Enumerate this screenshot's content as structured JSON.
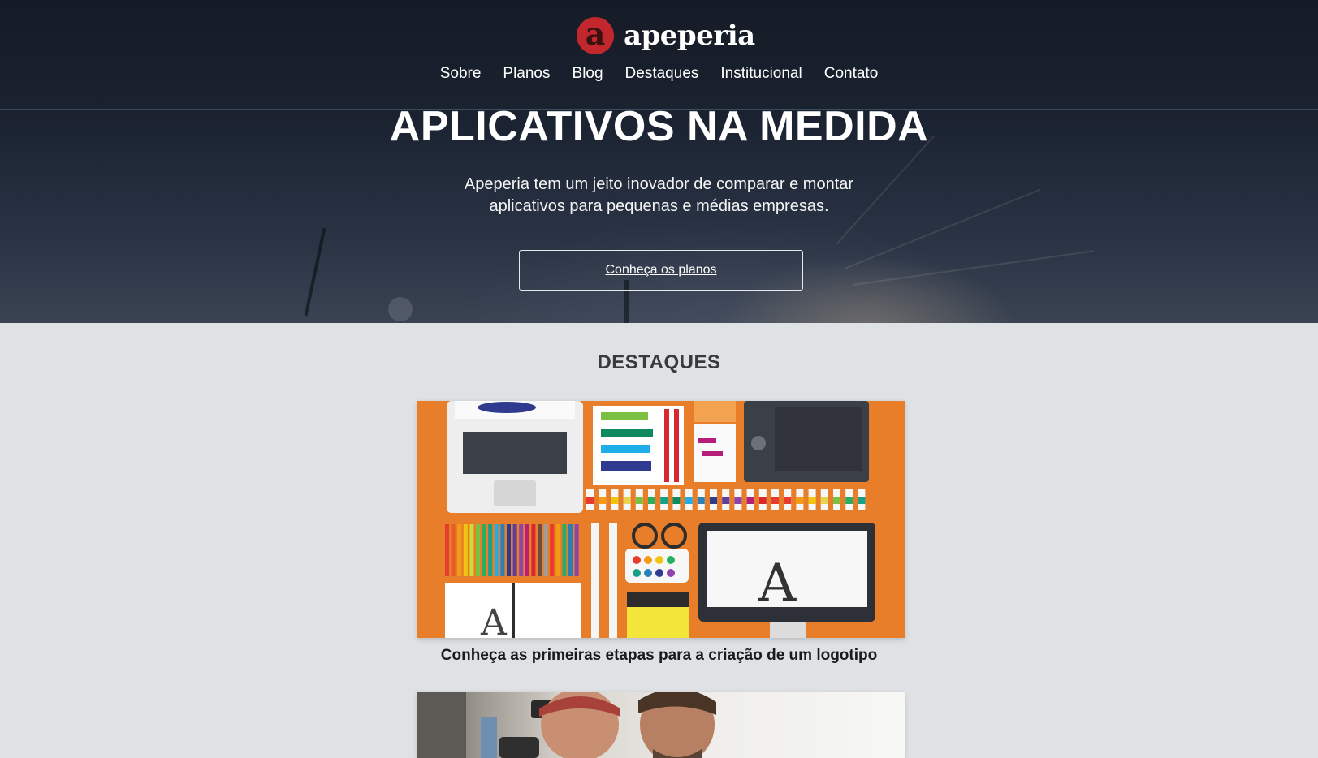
{
  "header": {
    "logo_letter": "a",
    "logo_name": "apeperia",
    "nav": [
      "Sobre",
      "Planos",
      "Blog",
      "Destaques",
      "Institucional",
      "Contato"
    ]
  },
  "hero": {
    "title": "APLICATIVOS NA MEDIDA",
    "subtitle": "Apeperia tem um jeito inovador de comparar e montar aplicativos para pequenas e médias empresas.",
    "cta_label": "Conheça os planos"
  },
  "highlights": {
    "title": "DESTAQUES",
    "cards": [
      {
        "caption": "Conheça as primeiras etapas para a criação de um logotipo"
      }
    ]
  },
  "colors": {
    "brand": "#c1272d",
    "card_orange": "#e87e2a",
    "page_bg": "#dfe2e5"
  }
}
